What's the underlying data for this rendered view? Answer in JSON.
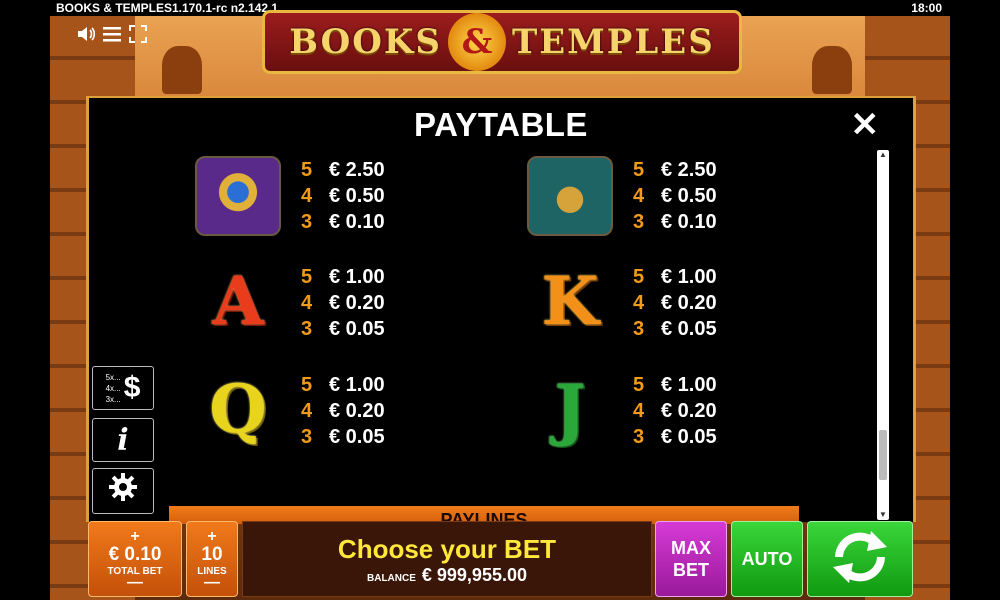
{
  "status_bar": {
    "app_name": "BOOKS & TEMPLES",
    "version": "1.170.1-rc n2.142.1",
    "clock": "18:00"
  },
  "hud": {
    "sound_icon": "speaker-icon",
    "menu_icon": "hamburger-icon",
    "fullscreen_icon": "fullscreen-icon"
  },
  "logo": {
    "word_left": "BOOKS",
    "ampersand": "&",
    "word_right": "TEMPLES"
  },
  "paytable": {
    "title": "PAYTABLE",
    "close_icon": "close-icon",
    "symbols": [
      {
        "id": "scarab-ring",
        "kind": "image",
        "pays": [
          {
            "count": "5",
            "amount": "€ 2.50"
          },
          {
            "count": "4",
            "amount": "€ 0.50"
          },
          {
            "count": "3",
            "amount": "€ 0.10"
          }
        ]
      },
      {
        "id": "eye-amulet",
        "kind": "image",
        "pays": [
          {
            "count": "5",
            "amount": "€ 2.50"
          },
          {
            "count": "4",
            "amount": "€ 0.50"
          },
          {
            "count": "3",
            "amount": "€ 0.10"
          }
        ]
      },
      {
        "id": "letter-a",
        "kind": "letter",
        "glyph": "A",
        "pays": [
          {
            "count": "5",
            "amount": "€ 1.00"
          },
          {
            "count": "4",
            "amount": "€ 0.20"
          },
          {
            "count": "3",
            "amount": "€ 0.05"
          }
        ]
      },
      {
        "id": "letter-k",
        "kind": "letter",
        "glyph": "K",
        "pays": [
          {
            "count": "5",
            "amount": "€ 1.00"
          },
          {
            "count": "4",
            "amount": "€ 0.20"
          },
          {
            "count": "3",
            "amount": "€ 0.05"
          }
        ]
      },
      {
        "id": "letter-q",
        "kind": "letter",
        "glyph": "Q",
        "pays": [
          {
            "count": "5",
            "amount": "€ 1.00"
          },
          {
            "count": "4",
            "amount": "€ 0.20"
          },
          {
            "count": "3",
            "amount": "€ 0.05"
          }
        ]
      },
      {
        "id": "letter-j",
        "kind": "letter",
        "glyph": "J",
        "pays": [
          {
            "count": "5",
            "amount": "€ 1.00"
          },
          {
            "count": "4",
            "amount": "€ 0.20"
          },
          {
            "count": "3",
            "amount": "€ 0.05"
          }
        ]
      }
    ],
    "next_section": "PAYLINES"
  },
  "side_buttons": {
    "paytable": {
      "mini_lines": [
        "5x...",
        "4x...",
        "3x..."
      ],
      "glyph": "$"
    },
    "info": {
      "glyph": "i"
    },
    "settings": {
      "icon": "gear-icon"
    }
  },
  "bet_bar": {
    "total_bet": {
      "plus": "+",
      "value": "€ 0.10",
      "label": "TOTAL BET",
      "minus": "—"
    },
    "lines": {
      "plus": "+",
      "value": "10",
      "label": "LINES",
      "minus": "—"
    },
    "message": "Choose your BET",
    "balance_label": "BALANCE",
    "balance_value": "€ 999,955.00",
    "max_bet": {
      "line1": "MAX",
      "line2": "BET"
    },
    "auto": "AUTO",
    "spin_icon": "spin-arrows-icon"
  },
  "colors": {
    "accent_orange": "#f29a1a",
    "panel_border": "#d9a33a",
    "message_yellow": "#ffe83a",
    "maxbet_purple": "#d63ad6",
    "spin_green": "#3ad63a"
  }
}
